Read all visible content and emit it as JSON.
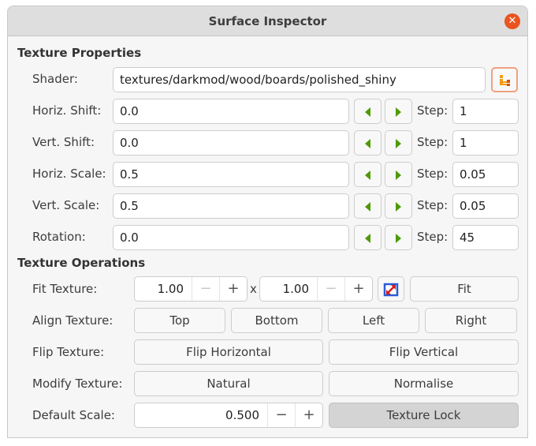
{
  "window": {
    "title": "Surface Inspector",
    "close_icon": "close-icon"
  },
  "texture_properties": {
    "heading": "Texture Properties",
    "shader": {
      "label": "Shader:",
      "value": "textures/darkmod/wood/boards/polished_shiny",
      "browse_icon": "folder-tree-icon"
    },
    "rows": [
      {
        "label": "Horiz. Shift:",
        "value": "0.0",
        "step_label": "Step:",
        "step": "1"
      },
      {
        "label": "Vert. Shift:",
        "value": "0.0",
        "step_label": "Step:",
        "step": "1"
      },
      {
        "label": "Horiz. Scale:",
        "value": "0.5",
        "step_label": "Step:",
        "step": "0.05"
      },
      {
        "label": "Vert. Scale:",
        "value": "0.5",
        "step_label": "Step:",
        "step": "0.05"
      },
      {
        "label": "Rotation:",
        "value": "0.0",
        "step_label": "Step:",
        "step": "45"
      }
    ]
  },
  "texture_operations": {
    "heading": "Texture Operations",
    "fit": {
      "label": "Fit Texture:",
      "width": "1.00",
      "height": "1.00",
      "separator": "x",
      "minus": "−",
      "plus": "+",
      "button": "Fit",
      "link_icon": "scale-link-icon"
    },
    "align": {
      "label": "Align Texture:",
      "buttons": [
        "Top",
        "Bottom",
        "Left",
        "Right"
      ]
    },
    "flip": {
      "label": "Flip Texture:",
      "buttons": [
        "Flip Horizontal",
        "Flip Vertical"
      ]
    },
    "modify": {
      "label": "Modify Texture:",
      "buttons": [
        "Natural",
        "Normalise"
      ]
    },
    "default_scale": {
      "label": "Default Scale:",
      "value": "0.500",
      "minus": "−",
      "plus": "+",
      "lock_button": "Texture Lock"
    }
  },
  "colors": {
    "accent_close": "#e9541f",
    "arrow_green": "#4e9a06",
    "browse_orange": "#f39c12"
  }
}
